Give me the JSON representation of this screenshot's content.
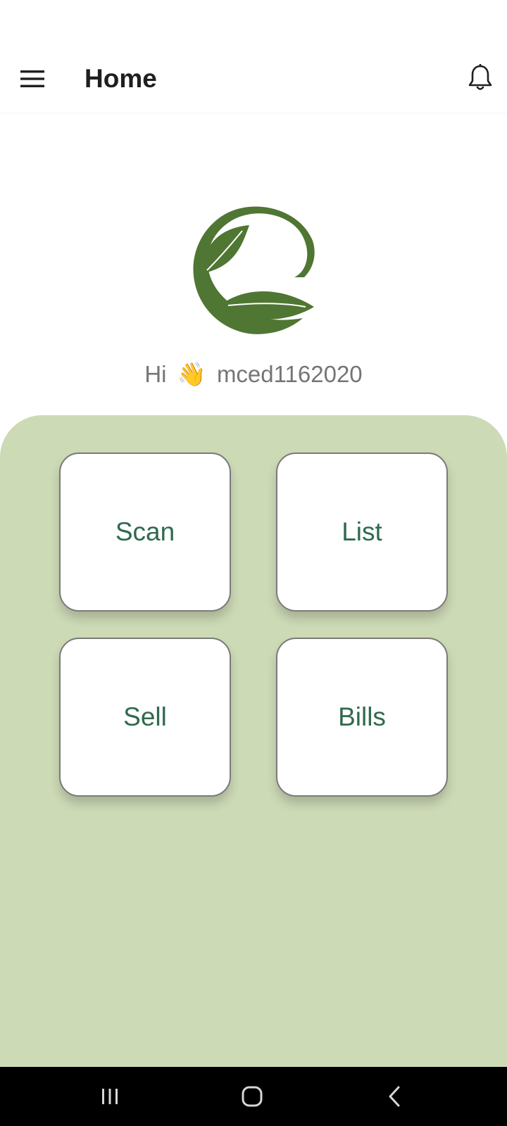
{
  "app_bar": {
    "title": "Home",
    "menu_icon": "hamburger-menu-icon",
    "notifications_icon": "bell-icon"
  },
  "logo": {
    "icon": "leaf-circle-logo",
    "color": "#4f7632"
  },
  "greeting": {
    "prefix": "Hi",
    "emoji": "👋",
    "username": "mced1162020"
  },
  "tiles": [
    {
      "label": "Scan"
    },
    {
      "label": "List"
    },
    {
      "label": "Sell"
    },
    {
      "label": "Bills"
    }
  ],
  "colors": {
    "panel_background": "#cddab6",
    "tile_text": "#2f6a4e",
    "greeting_text": "#757575"
  },
  "system_nav": {
    "recents_icon": "recents-icon",
    "home_icon": "home-icon",
    "back_icon": "back-icon"
  }
}
